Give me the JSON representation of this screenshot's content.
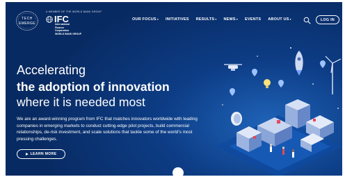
{
  "brand": {
    "tech_emerge_logo": "TECH EMERGE",
    "ifc_small_text": "A MEMBER OF THE WORLD BANK GROUP",
    "ifc_name": "IFC",
    "ifc_lines": "International\nFinance\nCorporation\nWORLD BANK GROUP"
  },
  "nav": {
    "items": [
      {
        "label": "OUR FOCUS",
        "caret": "▾"
      },
      {
        "label": "INITIATIVES",
        "caret": ""
      },
      {
        "label": "RESULTS",
        "caret": "▾"
      },
      {
        "label": "NEWS",
        "caret": "▾"
      },
      {
        "label": "EVENTS",
        "caret": ""
      },
      {
        "label": "ABOUT US",
        "caret": "▾"
      }
    ],
    "search_icon": "search-icon",
    "login_label": "LOG IN"
  },
  "hero": {
    "line1": "Accelerating",
    "line2": "the adoption of innovation",
    "line3": "where it is needed most",
    "description": "We are an award-winning program from IFC that matches innovators worldwide with leading companies in emerging markets to conduct cutting-edge pilot projects, build commercial relationships, de-risk investment, and scale solutions that tackle some of the world’s most pressing challenges.",
    "cta_label": "LEARN MORE",
    "cta_icon": "play-icon"
  },
  "colors": {
    "background": "#0d3d86",
    "accent": "#ffffff"
  }
}
